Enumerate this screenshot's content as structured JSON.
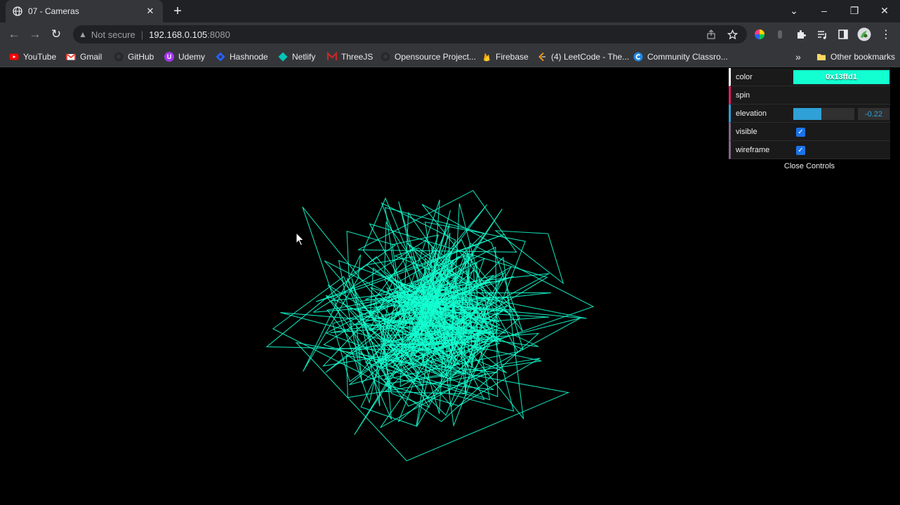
{
  "browser": {
    "tab": {
      "title": "07 - Cameras",
      "close": "✕"
    },
    "new_tab": "+",
    "window_controls": {
      "dropdown": "⌄",
      "minimize": "–",
      "restore": "❐",
      "close": "✕"
    },
    "nav": {
      "back": "←",
      "forward": "→",
      "reload": "↻"
    },
    "address": {
      "warning_icon": "▲",
      "security_text": "Not secure",
      "separator": "|",
      "host": "192.168.0.105",
      "port": ":8080"
    },
    "menu": "⋮"
  },
  "bookmarks": {
    "items": [
      {
        "label": "YouTube",
        "icon": "youtube-icon",
        "color": "#ff0000"
      },
      {
        "label": "Gmail",
        "icon": "gmail-icon",
        "color": "#ea4335"
      },
      {
        "label": "GitHub",
        "icon": "github-icon",
        "color": "#24292e"
      },
      {
        "label": "Udemy",
        "icon": "udemy-icon",
        "color": "#a435f0"
      },
      {
        "label": "Hashnode",
        "icon": "hashnode-icon",
        "color": "#2962ff"
      },
      {
        "label": "Netlify",
        "icon": "netlify-icon",
        "color": "#00c7b7"
      },
      {
        "label": "ThreeJS",
        "icon": "threejs-icon",
        "color": "#c62828"
      },
      {
        "label": "Opensource Project...",
        "icon": "github-icon",
        "color": "#24292e"
      },
      {
        "label": "Firebase",
        "icon": "firebase-icon",
        "color": "#ffca28"
      },
      {
        "label": "(4) LeetCode - The...",
        "icon": "leetcode-icon",
        "color": "#ffa116"
      },
      {
        "label": "Community Classro...",
        "icon": "classroom-icon",
        "color": "#1e88e5"
      }
    ],
    "overflow": "»",
    "other": "Other bookmarks"
  },
  "gui": {
    "color": {
      "label": "color",
      "value": "0x13ffd1"
    },
    "spin": {
      "label": "spin"
    },
    "elevation": {
      "label": "elevation",
      "value": "-0.22",
      "fraction": 0.46
    },
    "visible": {
      "label": "visible",
      "checked": true
    },
    "wireframe": {
      "label": "wireframe",
      "checked": true
    },
    "close": "Close Controls"
  },
  "scene": {
    "line_color": "#13ffd1",
    "background": "#000000"
  }
}
